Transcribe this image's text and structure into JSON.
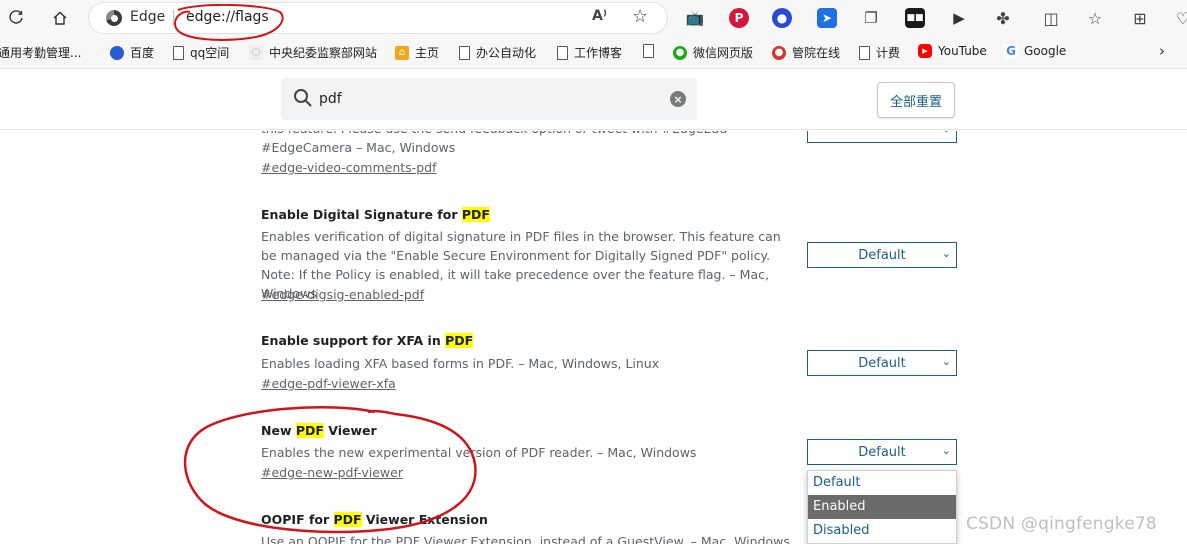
{
  "toolbar": {
    "address_label": "Edge",
    "url": "edge://flags",
    "read_aloud": "A⁾",
    "extensions": [
      "Pinterest",
      "Edge add-on",
      "Save to Drive",
      "Screenshot",
      "Media player",
      "Extensions"
    ]
  },
  "bookmarks": [
    {
      "label": "通用考勤管理...",
      "icon": "page-icon"
    },
    {
      "label": "百度",
      "icon": "baidu-icon"
    },
    {
      "label": "qq空间",
      "icon": "page-icon"
    },
    {
      "label": "中央纪委监察部网站",
      "icon": "ccdi-icon"
    },
    {
      "label": "主页",
      "icon": "home-icon"
    },
    {
      "label": "办公自动化",
      "icon": "page-icon"
    },
    {
      "label": "工作博客",
      "icon": "page-icon"
    },
    {
      "label": "",
      "icon": "page-icon"
    },
    {
      "label": "微信网页版",
      "icon": "wechat-icon"
    },
    {
      "label": "管院在线",
      "icon": "school-icon"
    },
    {
      "label": "计费",
      "icon": "page-icon"
    },
    {
      "label": "YouTube",
      "icon": "youtube-icon"
    },
    {
      "label": "Google",
      "icon": "google-icon"
    }
  ],
  "search": {
    "value": "pdf",
    "reset_label": "全部重置"
  },
  "experiments": [
    {
      "title_pre": "",
      "title_hl": "",
      "title_post": "",
      "description": "this feature. Please use the send feedback option or tweet with #EdgeEdu #EdgeCamera – Mac, Windows",
      "link": "#edge-video-comments-pdf",
      "select": ""
    },
    {
      "title_pre": "Enable Digital Signature for ",
      "title_hl": "PDF",
      "title_post": "",
      "description": "Enables verification of digital signature in PDF files in the browser. This feature can be managed via the \"Enable Secure Environment for Digitally Signed PDF\" policy. Note: If the Policy is enabled, it will take precedence over the feature flag. – Mac, Windows",
      "link": "#edge-digsig-enabled-pdf",
      "select": "Default"
    },
    {
      "title_pre": "Enable support for XFA in ",
      "title_hl": "PDF",
      "title_post": "",
      "description": "Enables loading XFA based forms in PDF. – Mac, Windows, Linux",
      "link": "#edge-pdf-viewer-xfa",
      "select": "Default"
    },
    {
      "title_pre": "New ",
      "title_hl": "PDF",
      "title_post": " Viewer",
      "description": "Enables the new experimental version of PDF reader. – Mac, Windows",
      "link": "#edge-new-pdf-viewer",
      "select": "Default"
    },
    {
      "title_pre": "OOPIF for ",
      "title_hl": "PDF",
      "title_post": " Viewer Extension",
      "description": "Use an OOPIF for the PDF Viewer Extension, instead of a GuestView. – Mac, Windows, Linux",
      "link": "",
      "select": ""
    }
  ],
  "dropdown": {
    "options": [
      "Default",
      "Enabled",
      "Disabled"
    ],
    "highlighted": "Enabled"
  },
  "watermark": "CSDN @qingfengke78",
  "colors": {
    "accent": "#1a5f8c",
    "highlight": "#ffff00",
    "annotation": "#d2141a"
  }
}
